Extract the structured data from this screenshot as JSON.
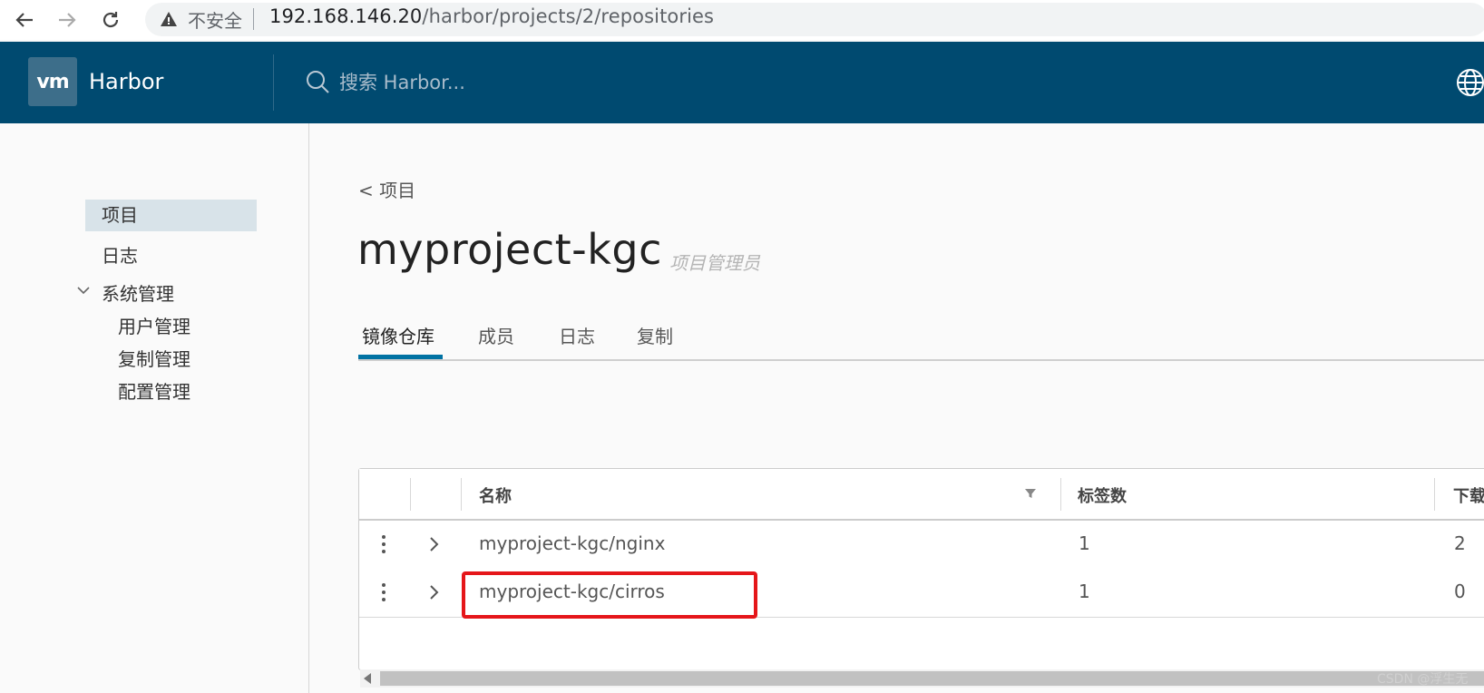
{
  "browser": {
    "insecure_label": "不安全",
    "url_host": "192.168.146.20",
    "url_path": "/harbor/projects/2/repositories"
  },
  "header": {
    "logo_text": "vm",
    "app_name": "Harbor",
    "search_placeholder": "搜索 Harbor..."
  },
  "sidebar": {
    "items": [
      {
        "label": "项目"
      },
      {
        "label": "日志"
      },
      {
        "label": "系统管理"
      },
      {
        "label": "用户管理"
      },
      {
        "label": "复制管理"
      },
      {
        "label": "配置管理"
      }
    ]
  },
  "main": {
    "breadcrumb": "< 项目",
    "title": "myproject-kgc",
    "role": "项目管理员",
    "tabs": [
      {
        "label": "镜像仓库"
      },
      {
        "label": "成员"
      },
      {
        "label": "日志"
      },
      {
        "label": "复制"
      }
    ]
  },
  "table": {
    "headers": {
      "name": "名称",
      "tags": "标签数",
      "downloads": "下载"
    },
    "rows": [
      {
        "name": "myproject-kgc/nginx",
        "tags": "1",
        "downloads": "2"
      },
      {
        "name": "myproject-kgc/cirros",
        "tags": "1",
        "downloads": "0"
      }
    ]
  },
  "watermark": "CSDN @浮生无",
  "colors": {
    "header_bg": "#004a70",
    "tab_active": "#0072a3",
    "highlight": "#e5161a"
  }
}
